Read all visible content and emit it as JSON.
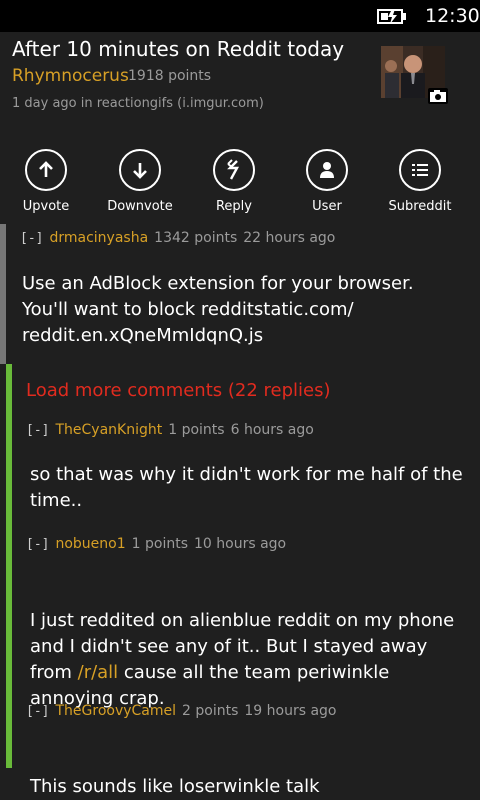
{
  "status_bar": {
    "time": "12:30",
    "battery_icon": "battery-charging-icon"
  },
  "post": {
    "title": "After 10 minutes on Reddit today",
    "author": "Rhymnocerus",
    "points": "1918 points",
    "meta": "1 day ago in reactiongifs  (i.imgur.com)",
    "thumbnail_icon": "camera-icon"
  },
  "actions": [
    {
      "label": "Upvote",
      "icon": "arrow-up-icon"
    },
    {
      "label": "Downvote",
      "icon": "arrow-down-icon"
    },
    {
      "label": "Reply",
      "icon": "reply-icon"
    },
    {
      "label": "User",
      "icon": "user-icon"
    },
    {
      "label": "Subreddit",
      "icon": "list-icon"
    }
  ],
  "comments": [
    {
      "toggle": "[-]",
      "author": "drmacinyasha",
      "points": "1342 points",
      "time": "22 hours ago",
      "body": "Use an AdBlock extension for your browser.\nYou'll want to block redditstatic.com/\nreddit.en.xQneMmIdqnQ.js"
    },
    {
      "toggle": "[-]",
      "author": "TheCyanKnight",
      "points": "1 points",
      "time": "6 hours ago",
      "body": "so that was why it didn't work for me half of the\ntime.."
    },
    {
      "toggle": "[-]",
      "author": "nobueno1",
      "points": "1 points",
      "time": "10 hours ago",
      "body_pre": "I just reddited on alienblue reddit on my phone\nand I didn't see any of it.. But I stayed away\nfrom ",
      "body_link": "/r/all",
      "body_post": " cause all the team periwinkle\nannoying crap."
    },
    {
      "toggle": "[-]",
      "author": "TheGroovyCamel",
      "points": "2 points",
      "time": "19 hours ago",
      "body": "This sounds like loserwinkle talk"
    }
  ],
  "load_more": "Load more comments (22 replies)",
  "colors": {
    "background": "#1f1f1f",
    "accent": "#d7a026",
    "load_more": "#e12b1f",
    "thread_bar": "#69ba3a"
  }
}
